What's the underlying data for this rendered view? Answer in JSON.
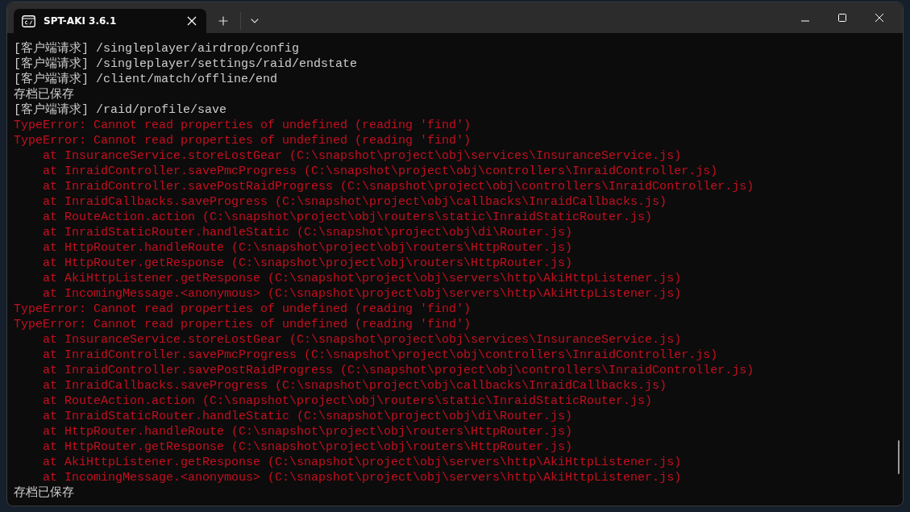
{
  "window": {
    "tab": {
      "title": "SPT-AKI 3.6.1",
      "selected": true
    }
  },
  "lines": [
    {
      "kind": "info",
      "text": "[客户端请求] /singleplayer/airdrop/config"
    },
    {
      "kind": "info",
      "text": "[客户端请求] /singleplayer/settings/raid/endstate"
    },
    {
      "kind": "info",
      "text": "[客户端请求] /client/match/offline/end"
    },
    {
      "kind": "info",
      "text": "存档已保存"
    },
    {
      "kind": "info",
      "text": "[客户端请求] /raid/profile/save"
    },
    {
      "kind": "error",
      "text": "TypeError: Cannot read properties of undefined (reading 'find')"
    },
    {
      "kind": "error",
      "text": "TypeError: Cannot read properties of undefined (reading 'find')"
    },
    {
      "kind": "trace",
      "text": "at InsuranceService.storeLostGear (C:\\snapshot\\project\\obj\\services\\InsuranceService.js)"
    },
    {
      "kind": "trace",
      "text": "at InraidController.savePmcProgress (C:\\snapshot\\project\\obj\\controllers\\InraidController.js)"
    },
    {
      "kind": "trace",
      "text": "at InraidController.savePostRaidProgress (C:\\snapshot\\project\\obj\\controllers\\InraidController.js)"
    },
    {
      "kind": "trace",
      "text": "at InraidCallbacks.saveProgress (C:\\snapshot\\project\\obj\\callbacks\\InraidCallbacks.js)"
    },
    {
      "kind": "trace",
      "text": "at RouteAction.action (C:\\snapshot\\project\\obj\\routers\\static\\InraidStaticRouter.js)"
    },
    {
      "kind": "trace",
      "text": "at InraidStaticRouter.handleStatic (C:\\snapshot\\project\\obj\\di\\Router.js)"
    },
    {
      "kind": "trace",
      "text": "at HttpRouter.handleRoute (C:\\snapshot\\project\\obj\\routers\\HttpRouter.js)"
    },
    {
      "kind": "trace",
      "text": "at HttpRouter.getResponse (C:\\snapshot\\project\\obj\\routers\\HttpRouter.js)"
    },
    {
      "kind": "trace",
      "text": "at AkiHttpListener.getResponse (C:\\snapshot\\project\\obj\\servers\\http\\AkiHttpListener.js)"
    },
    {
      "kind": "trace",
      "text": "at IncomingMessage.<anonymous> (C:\\snapshot\\project\\obj\\servers\\http\\AkiHttpListener.js)"
    },
    {
      "kind": "error",
      "text": "TypeError: Cannot read properties of undefined (reading 'find')"
    },
    {
      "kind": "error",
      "text": "TypeError: Cannot read properties of undefined (reading 'find')"
    },
    {
      "kind": "trace",
      "text": "at InsuranceService.storeLostGear (C:\\snapshot\\project\\obj\\services\\InsuranceService.js)"
    },
    {
      "kind": "trace",
      "text": "at InraidController.savePmcProgress (C:\\snapshot\\project\\obj\\controllers\\InraidController.js)"
    },
    {
      "kind": "trace",
      "text": "at InraidController.savePostRaidProgress (C:\\snapshot\\project\\obj\\controllers\\InraidController.js)"
    },
    {
      "kind": "trace",
      "text": "at InraidCallbacks.saveProgress (C:\\snapshot\\project\\obj\\callbacks\\InraidCallbacks.js)"
    },
    {
      "kind": "trace",
      "text": "at RouteAction.action (C:\\snapshot\\project\\obj\\routers\\static\\InraidStaticRouter.js)"
    },
    {
      "kind": "trace",
      "text": "at InraidStaticRouter.handleStatic (C:\\snapshot\\project\\obj\\di\\Router.js)"
    },
    {
      "kind": "trace",
      "text": "at HttpRouter.handleRoute (C:\\snapshot\\project\\obj\\routers\\HttpRouter.js)"
    },
    {
      "kind": "trace",
      "text": "at HttpRouter.getResponse (C:\\snapshot\\project\\obj\\routers\\HttpRouter.js)"
    },
    {
      "kind": "trace",
      "text": "at AkiHttpListener.getResponse (C:\\snapshot\\project\\obj\\servers\\http\\AkiHttpListener.js)"
    },
    {
      "kind": "trace",
      "text": "at IncomingMessage.<anonymous> (C:\\snapshot\\project\\obj\\servers\\http\\AkiHttpListener.js)"
    },
    {
      "kind": "info",
      "text": "存档已保存"
    }
  ]
}
